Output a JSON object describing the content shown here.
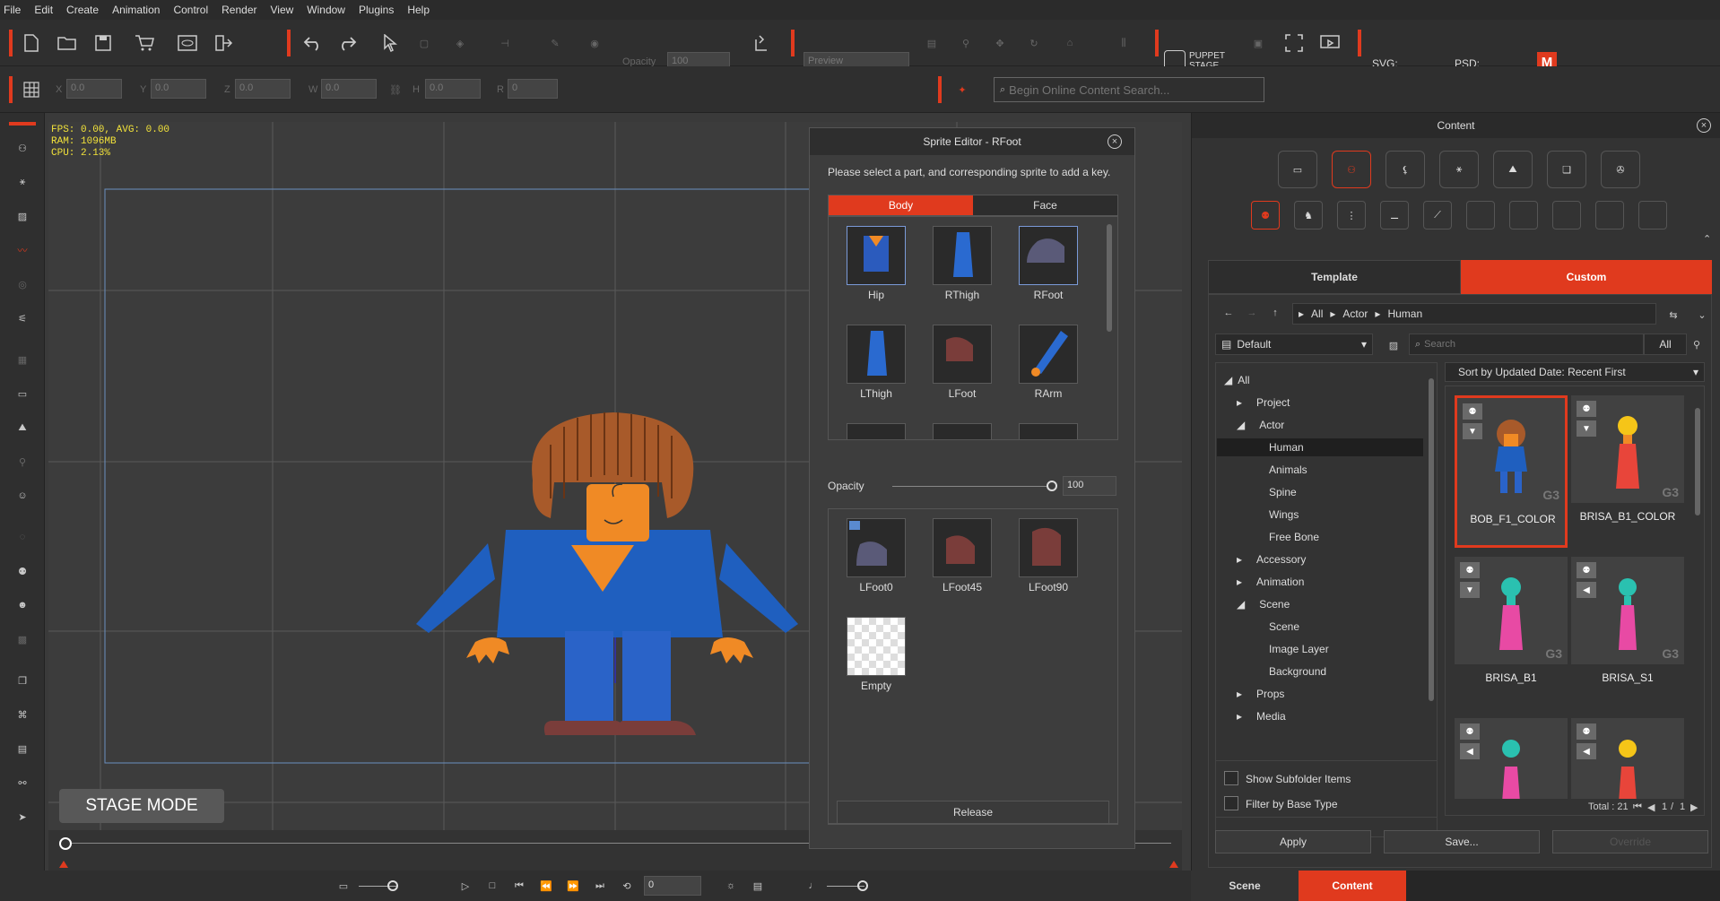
{
  "menu": [
    "File",
    "Edit",
    "Create",
    "Animation",
    "Control",
    "Render",
    "View",
    "Window",
    "Plugins",
    "Help"
  ],
  "toolbar": {
    "opacity_label": "Opacity",
    "opacity_value": "100",
    "preview_label": "Preview",
    "puppet_stage_line1": "PUPPET",
    "puppet_stage_line2": "STAGE",
    "svg_label": "SVG:",
    "psd_label": "PSD:",
    "m_badge": "M"
  },
  "transform": {
    "x_label": "X",
    "x_value": "0.0",
    "y_label": "Y",
    "y_value": "0.0",
    "z_label": "Z",
    "z_value": "0.0",
    "w_label": "W",
    "w_value": "0.0",
    "h_label": "H",
    "h_value": "0.0",
    "r_label": "R",
    "r_value": "0"
  },
  "search": {
    "placeholder": "Begin Online Content Search..."
  },
  "stats": {
    "line1": "FPS: 0.00, AVG: 0.00",
    "line2": "RAM: 1096MB",
    "line3": "CPU: 2.13%"
  },
  "stage_mode": "STAGE MODE",
  "sprite_editor": {
    "title": "Sprite Editor - RFoot",
    "instruction": "Please select a part, and corresponding sprite to add a key.",
    "tabs": [
      {
        "label": "Body",
        "active": true
      },
      {
        "label": "Face",
        "active": false
      }
    ],
    "parts": [
      {
        "label": "Hip",
        "icon": "hip-icon",
        "color": "#2b5bbd"
      },
      {
        "label": "RThigh",
        "icon": "thigh-icon",
        "color": "#2a6ad0"
      },
      {
        "label": "RFoot",
        "icon": "foot-icon",
        "color": "#5a5a78"
      },
      {
        "label": "LThigh",
        "icon": "thigh-icon",
        "color": "#2a6ad0"
      },
      {
        "label": "LFoot",
        "icon": "foot-icon",
        "color": "#7a3d3a"
      },
      {
        "label": "RArm",
        "icon": "arm-icon",
        "color": "#2a6ad0"
      }
    ],
    "opacity_label": "Opacity",
    "opacity_value": "100",
    "sprites": [
      {
        "label": "LFoot0",
        "color": "#5a5a78"
      },
      {
        "label": "LFoot45",
        "color": "#7a3d3a"
      },
      {
        "label": "LFoot90",
        "color": "#7a3d3a"
      },
      {
        "label": "Empty",
        "color": ""
      }
    ],
    "release": "Release"
  },
  "timeline": {
    "frame_value": "0"
  },
  "content": {
    "title": "Content",
    "tabs": [
      {
        "label": "Template",
        "active": false
      },
      {
        "label": "Custom",
        "active": true
      }
    ],
    "breadcrumb": [
      "All",
      "Actor",
      "Human"
    ],
    "filter_default": "Default",
    "search_placeholder": "Search",
    "all_label": "All",
    "sort_label": "Sort by Updated Date: Recent First",
    "tree": [
      {
        "label": "All",
        "level": 0
      },
      {
        "label": "Project",
        "level": 1
      },
      {
        "label": "Actor",
        "level": 1
      },
      {
        "label": "Human",
        "level": 2,
        "selected": true
      },
      {
        "label": "Animals",
        "level": 2
      },
      {
        "label": "Spine",
        "level": 2
      },
      {
        "label": "Wings",
        "level": 2
      },
      {
        "label": "Free Bone",
        "level": 2
      },
      {
        "label": "Accessory",
        "level": 1
      },
      {
        "label": "Animation",
        "level": 1
      },
      {
        "label": "Scene",
        "level": 1
      },
      {
        "label": "Scene",
        "level": 2
      },
      {
        "label": "Image Layer",
        "level": 2
      },
      {
        "label": "Background",
        "level": 2
      },
      {
        "label": "Props",
        "level": 1
      },
      {
        "label": "Media",
        "level": 1
      }
    ],
    "show_subfolder": "Show Subfolder Items",
    "filter_base": "Filter by Base Type",
    "items": [
      {
        "label": "BOB_F1_COLOR",
        "selected": true,
        "badge": "G3"
      },
      {
        "label": "BRISA_B1_COLOR",
        "selected": false,
        "badge": "G3"
      },
      {
        "label": "BRISA_B1",
        "selected": false,
        "badge": "G3"
      },
      {
        "label": "BRISA_S1",
        "selected": false,
        "badge": "G3"
      },
      {
        "label": "",
        "selected": false,
        "badge": ""
      },
      {
        "label": "",
        "selected": false,
        "badge": ""
      }
    ],
    "total": "Total : 21",
    "page_current": "1",
    "page_sep": "/",
    "page_total": "1",
    "apply": "Apply",
    "save": "Save...",
    "override": "Override"
  },
  "bottom_tabs": [
    {
      "label": "Scene",
      "active": false
    },
    {
      "label": "Content",
      "active": true
    }
  ],
  "colors": {
    "accent": "#e03a1e",
    "bg": "#3a3a3a",
    "panel": "#333333"
  }
}
